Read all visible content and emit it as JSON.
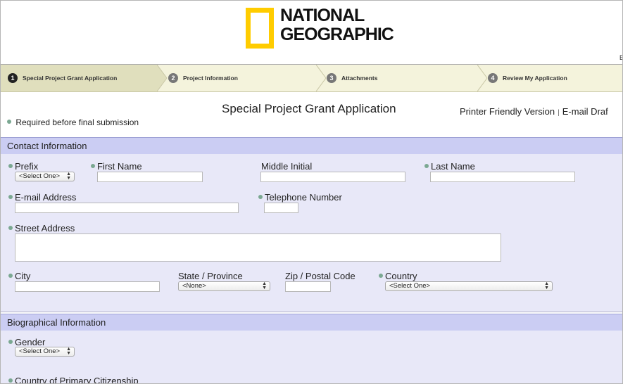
{
  "header": {
    "logo_line1": "NATIONAL",
    "logo_line2": "GEOGRAPHIC",
    "corner_letter": "E"
  },
  "steps": [
    {
      "number": "1",
      "label": "Special Project Grant Application"
    },
    {
      "number": "2",
      "label": "Project Information"
    },
    {
      "number": "3",
      "label": "Attachments"
    },
    {
      "number": "4",
      "label": "Review My Application"
    }
  ],
  "form": {
    "title": "Special Project Grant Application",
    "printer_friendly": "Printer Friendly Version",
    "separator": "|",
    "email_draft": "E-mail Draf",
    "required_note": "Required before final submission"
  },
  "contact": {
    "heading": "Contact Information",
    "prefix_label": "Prefix",
    "prefix_value": "<Select One>",
    "first_name_label": "First Name",
    "middle_initial_label": "Middle Initial",
    "last_name_label": "Last Name",
    "email_label": "E-mail Address",
    "telephone_label": "Telephone Number",
    "street_label": "Street Address",
    "city_label": "City",
    "state_label": "State / Province",
    "state_value": "<None>",
    "zip_label": "Zip / Postal Code",
    "country_label": "Country",
    "country_value": "<Select One>"
  },
  "bio": {
    "heading": "Biographical Information",
    "gender_label": "Gender",
    "gender_value": "<Select One>",
    "citizenship_label": "Country of Primary Citizenship"
  },
  "colors": {
    "logo_yellow": "#ffcc00",
    "section_header": "#cbcdf3",
    "section_body": "#e8e8f8",
    "required_dot": "#7ba892",
    "steps_bg": "#f4f3dc"
  }
}
